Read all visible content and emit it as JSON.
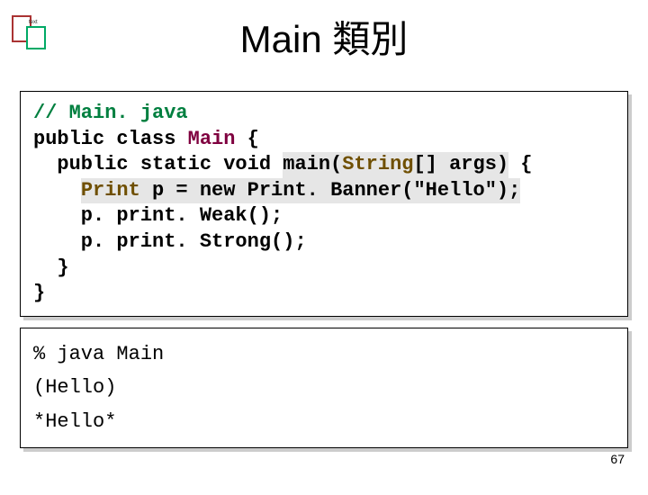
{
  "title": "Main 類別",
  "code": {
    "l1": "// Main. java",
    "l2a": "public class ",
    "l2b": "Main",
    "l2c": " {",
    "l3a": "  public static void ",
    "l3b": "main(",
    "l3c": "String",
    "l3d": "[] args)",
    "l3e": " {",
    "l4a": "    ",
    "l4b": "Print",
    "l4c": " p = new Print. Banner(\"Hello\");",
    "l5": "    p. print. Weak();",
    "l6": "    p. print. Strong();",
    "l7": "  }",
    "l8": "}"
  },
  "output": {
    "l1": "% java Main",
    "l2": "(Hello)",
    "l3": "*Hello*"
  },
  "page": "67"
}
